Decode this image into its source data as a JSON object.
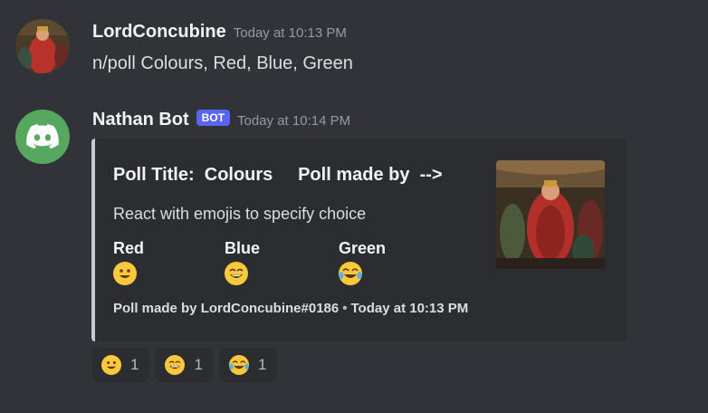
{
  "messages": [
    {
      "username": "LordConcubine",
      "timestamp": "Today at 10:13 PM",
      "text": "n/poll Colours, Red, Blue, Green",
      "avatar": "painting-avatar"
    },
    {
      "username": "Nathan Bot",
      "bot_tag": "BOT",
      "timestamp": "Today at 10:14 PM",
      "avatar": "discord-logo-icon",
      "avatar_color": "#57a85f"
    }
  ],
  "embed": {
    "title": "Poll Title:  Colours     Poll made by  -->",
    "description": "React with emojis to specify choice",
    "fields": [
      {
        "name": "Red",
        "emoji": "grinning-face-icon"
      },
      {
        "name": "Blue",
        "emoji": "grinning-face-big-eyes-icon"
      },
      {
        "name": "Green",
        "emoji": "tears-of-joy-icon"
      }
    ],
    "footer_text": "Poll made by LordConcubine#0186",
    "footer_separator": "•",
    "footer_timestamp": "Today at 10:13 PM",
    "border_color": "#c9cdd2",
    "thumbnail": "painting-thumbnail"
  },
  "reactions": [
    {
      "emoji": "grinning-face-icon",
      "count": "1"
    },
    {
      "emoji": "grinning-face-big-eyes-icon",
      "count": "1"
    },
    {
      "emoji": "tears-of-joy-icon",
      "count": "1"
    }
  ],
  "colors": {
    "background": "#313338",
    "embed_bg": "#2b2d31",
    "bot_tag": "#5865f2",
    "emoji": "#fbc93b"
  }
}
